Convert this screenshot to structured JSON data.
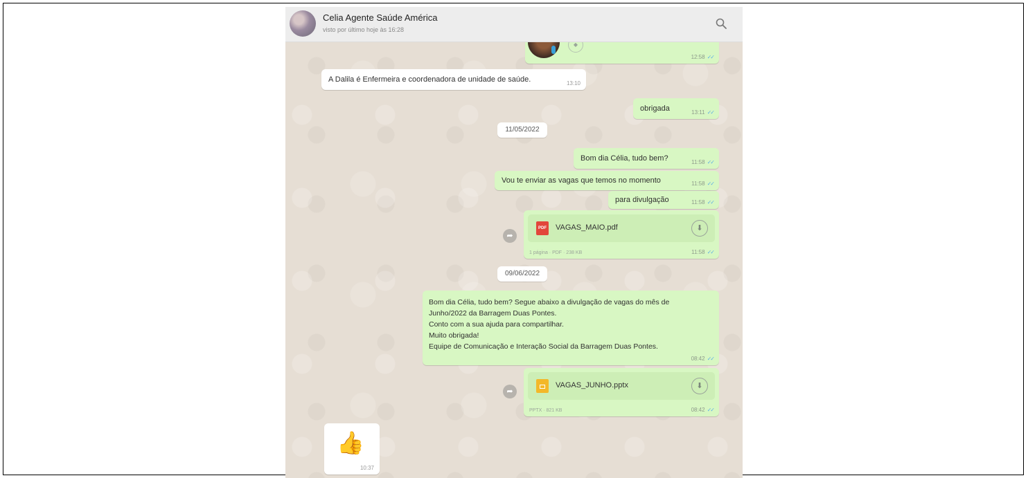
{
  "header": {
    "contact_name": "Celia Agente Saúde América",
    "last_seen": "visto por último hoje às 16:28"
  },
  "icons": {
    "search": "search-icon",
    "forward": "forward-icon",
    "download": "download-icon"
  },
  "messages": {
    "m0_time": "12:58",
    "m1_text": "A Dalila é Enfermeira e  coordenadora de unidade de saúde.",
    "m1_time": "13:10",
    "m2_text": "obrigada",
    "m2_time": "13:11",
    "date1": "11/05/2022",
    "m3_text": "Bom dia Célia, tudo bem?",
    "m3_time": "11:58",
    "m4_text": "Vou te enviar as vagas que temos no momento",
    "m4_time": "11:58",
    "m5_text": "para divulgação",
    "m5_time": "11:58",
    "doc1_name": "VAGAS_MAIO.pdf",
    "doc1_meta": "1 página · PDF · 238 KB",
    "doc1_time": "11:58",
    "doc1_badge": "PDF",
    "date2": "09/06/2022",
    "m6_lines": [
      "Bom dia Célia, tudo bem? Segue abaixo a divulgação de vagas do mês de",
      "Junho/2022 da Barragem Duas Pontes.",
      "Conto com a sua ajuda para compartilhar.",
      "Muito obrigada!",
      "Equipe de Comunicação e Interação Social da Barragem Duas Pontes."
    ],
    "m6_time": "08:42",
    "doc2_name": "VAGAS_JUNHO.pptx",
    "doc2_meta": "PPTX · 821 KB",
    "doc2_time": "08:42",
    "m7_emoji": "👍",
    "m7_time": "10:37"
  },
  "colors": {
    "outgoing_bubble": "#d8f7c3",
    "incoming_bubble": "#ffffff",
    "chat_background": "#e6ded4",
    "read_ticks": "#5fb0e5"
  }
}
